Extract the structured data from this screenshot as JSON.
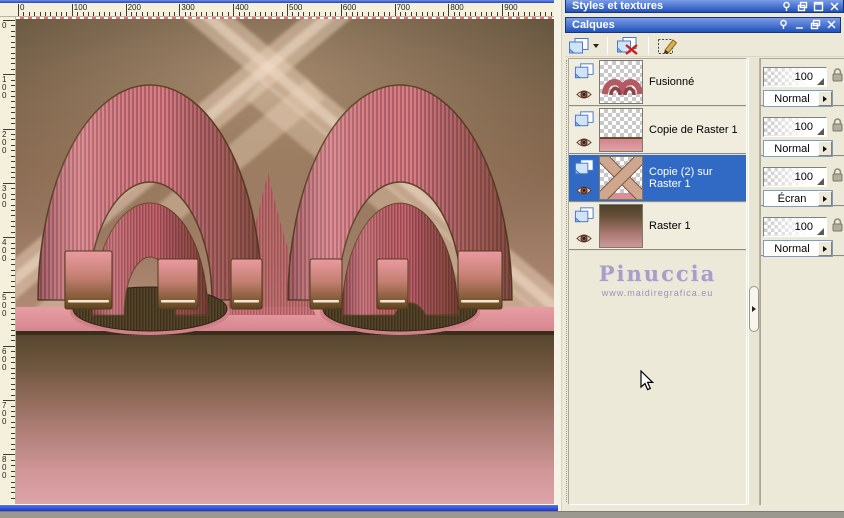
{
  "window_chrome": {
    "canvas_top_strip_color": "#2f55c8",
    "bottom_scroll_color": "#1d35c8",
    "taskbar_color": "#9b9890"
  },
  "rulers": {
    "horizontal_labels": [
      "0",
      "100",
      "200",
      "300",
      "400",
      "500",
      "600",
      "700",
      "800",
      "900"
    ],
    "vertical_labels": [
      "0",
      "100",
      "200",
      "300",
      "400",
      "500",
      "600",
      "700",
      "800"
    ]
  },
  "panels": {
    "styles_textures": {
      "title": "Styles et textures",
      "buttons": [
        "pin",
        "restore",
        "maximize",
        "close"
      ]
    },
    "calques": {
      "title": "Calques",
      "buttons": [
        "pin",
        "minimize",
        "restore",
        "close"
      ],
      "toolbar": [
        {
          "name": "new-layer",
          "icon": "pages-icon",
          "has_dropdown": true
        },
        {
          "name": "delete-layer",
          "icon": "page-red-x-icon"
        },
        {
          "name": "edit-selection",
          "icon": "dashed-square-pencil-icon"
        }
      ],
      "layers": [
        {
          "name": "Fusionné",
          "opacity": "100",
          "blend_mode": "Normal",
          "selected": false,
          "visible": true,
          "thumb": "arches"
        },
        {
          "name": "Copie de Raster 1",
          "opacity": "100",
          "blend_mode": "Normal",
          "selected": false,
          "visible": true,
          "thumb": "shelf"
        },
        {
          "name": "Copie (2) sur Raster 1",
          "opacity": "100",
          "blend_mode": "Écran",
          "selected": true,
          "visible": true,
          "thumb": "cross"
        },
        {
          "name": "Raster 1",
          "opacity": "100",
          "blend_mode": "Normal",
          "selected": false,
          "visible": true,
          "thumb": "gradient"
        }
      ],
      "watermark": {
        "line1": "Pinuccia",
        "line2": "www.maidiregrafica.eu"
      }
    }
  },
  "colors": {
    "panel_bg": "#ece9d8",
    "selection_blue": "#316ac5",
    "titlebar_top": "#7b9ce8",
    "titlebar_bottom": "#2253b8",
    "artwork_pink": "#db7e86",
    "artwork_brown": "#6a5238"
  }
}
